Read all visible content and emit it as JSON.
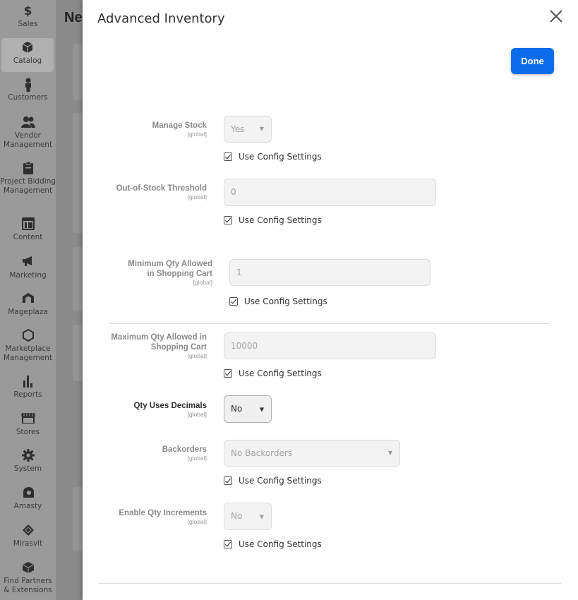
{
  "sidebar": {
    "items": [
      {
        "label": "Sales",
        "icon": "dollar-icon"
      },
      {
        "label": "Catalog",
        "icon": "box-icon",
        "active": true
      },
      {
        "label": "Customers",
        "icon": "person-icon"
      },
      {
        "label": "Vendor Management",
        "icon": "users-icon"
      },
      {
        "label": "Project Bidding Management",
        "icon": "clipboard-icon"
      },
      {
        "label": "Content",
        "icon": "layout-icon"
      },
      {
        "label": "Marketing",
        "icon": "megaphone-icon"
      },
      {
        "label": "Mageplaza",
        "icon": "mageplaza-icon"
      },
      {
        "label": "Marketplace Management",
        "icon": "hexagon-icon"
      },
      {
        "label": "Reports",
        "icon": "bar-chart-icon"
      },
      {
        "label": "Stores",
        "icon": "store-icon"
      },
      {
        "label": "System",
        "icon": "gear-icon"
      },
      {
        "label": "Amasty",
        "icon": "amasty-icon"
      },
      {
        "label": "Mirasvit",
        "icon": "mirasvit-icon"
      },
      {
        "label": "Find Partners & Extensions",
        "icon": "partners-icon"
      }
    ]
  },
  "background_page": {
    "title": "Ne"
  },
  "modal": {
    "title": "Advanced Inventory",
    "done_label": "Done",
    "close_icon": "close-icon",
    "scope_label": "[global]",
    "use_config_label": "Use Config Settings",
    "fields": {
      "manage_stock": {
        "label": "Manage Stock",
        "value": "Yes"
      },
      "out_of_stock_threshold": {
        "label": "Out-of-Stock Threshold",
        "value": "0"
      },
      "min_qty_cart": {
        "label_line1": "Minimum Qty Allowed",
        "label_line2": "in Shopping Cart",
        "value": "1"
      },
      "max_qty_cart": {
        "label_line1": "Maximum Qty Allowed in",
        "label_line2": "Shopping Cart",
        "value": "10000"
      },
      "qty_uses_decimals": {
        "label": "Qty Uses Decimals",
        "value": "No"
      },
      "backorders": {
        "label": "Backorders",
        "value": "No Backorders"
      },
      "enable_qty_increments": {
        "label": "Enable Qty Increments",
        "value": "No"
      }
    }
  }
}
